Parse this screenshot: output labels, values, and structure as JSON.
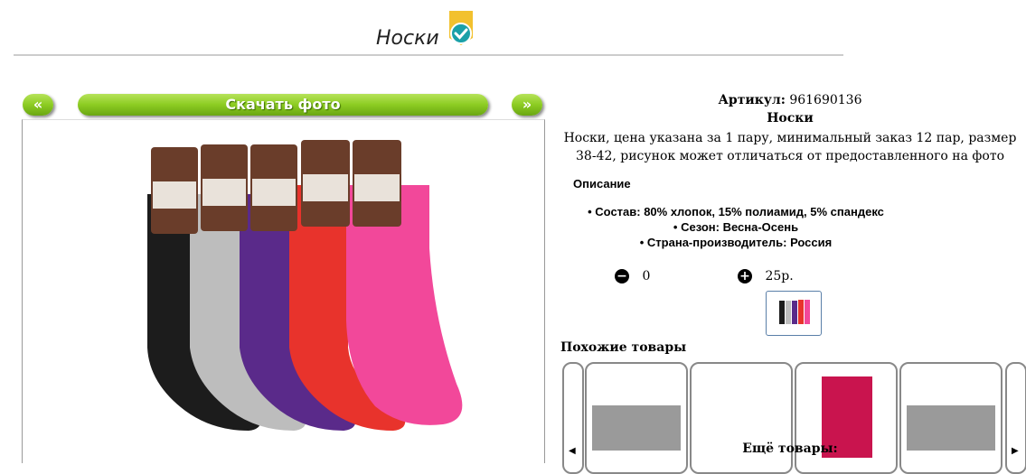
{
  "header": {
    "title": "Носки"
  },
  "gallery": {
    "prev_label": "«",
    "download_label": "Скачать фото",
    "next_label": "»"
  },
  "product": {
    "sku_label": "Артикул:",
    "sku": "961690136",
    "name": "Носки",
    "description": "Носки, цена указана за 1 пару, минимальный заказ 12 пар, размер 38-42, рисунок может отличаться от предоставленного на фото"
  },
  "specs": {
    "title": "Описание",
    "items": [
      "Состав: 80% хлопок, 15% полиамид, 5% спандекс",
      "Сезон: Весна-Осень",
      "Страна-производитель: Россия"
    ]
  },
  "order": {
    "quantity": "0",
    "price": "25р."
  },
  "similar": {
    "title": "Похожие товары",
    "more_label": "Ещё товары:"
  },
  "colors": {
    "accent_green": "#8ccc22",
    "badge_yellow": "#f2c12e",
    "badge_teal": "#1aa0a8"
  }
}
